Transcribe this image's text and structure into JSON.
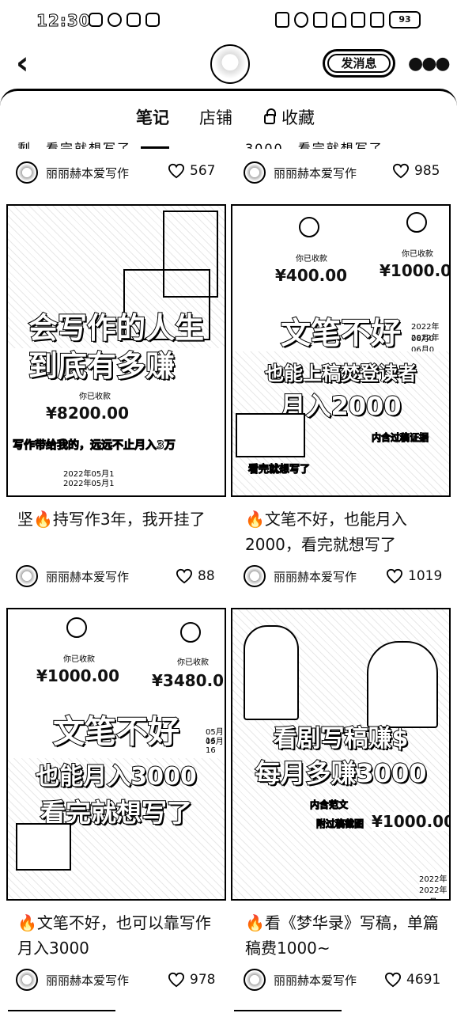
{
  "status_bar": {
    "time": "12:30",
    "battery": "93"
  },
  "header": {
    "back_icon": "chevron-left-icon",
    "message_button": "发消息",
    "more_icon": "more-dots-icon"
  },
  "tabs": [
    {
      "label": "笔记",
      "active": true
    },
    {
      "label": "店铺",
      "active": false
    },
    {
      "label": "收藏",
      "active": false,
      "icon": "lock-icon"
    }
  ],
  "top_partial_row": {
    "left": {
      "partial_text": "剩，看完就想写了",
      "author": "丽丽赫本爱写作",
      "likes": "567"
    },
    "right": {
      "partial_text": "3000，看完就想写了",
      "author": "丽丽赫本爱写作",
      "likes": "985"
    }
  },
  "notes": [
    {
      "cover": {
        "headline_1": "会写作的人生",
        "headline_2": "到底有多赚",
        "amount": "¥8200.00",
        "received": "你已收款",
        "sticker": "写作带给我的，远远不止月入3万",
        "dates": [
          "2022年05月1",
          "2022年05月1"
        ]
      },
      "title": "坚🔥持写作3年，我开挂了",
      "author": "丽丽赫本爱写作",
      "likes": "88"
    },
    {
      "cover": {
        "amount_1": "¥400.00",
        "amount_2": "¥1000.00",
        "received": "你已收款",
        "headline_1": "文笔不好",
        "headline_2": "也能上稿焚登读者",
        "headline_3": "月入2000",
        "sticker_1": "内含过稿证据",
        "sticker_2": "看完就想写了",
        "dates": [
          "2022年06月0",
          "2022年06月0"
        ]
      },
      "title": "🔥文笔不好，也能月入2000，看完就想写了",
      "author": "丽丽赫本爱写作",
      "likes": "1019"
    },
    {
      "cover": {
        "amount_1": "¥1000.00",
        "amount_2": "¥3480.00",
        "received": "你已收款",
        "headline_1": "文笔不好",
        "headline_2": "也能月入3000",
        "headline_3": "看完就想写了",
        "dates": [
          "05月16",
          "05月16"
        ]
      },
      "title": "🔥文笔不好，也可以靠写作月入3000",
      "author": "丽丽赫本爱写作",
      "likes": "978"
    },
    {
      "cover": {
        "headline_1": "看剧写稿赚$",
        "headline_2": "每月多赚3000",
        "sticker_1": "内含范文",
        "sticker_2": "附过稿截图",
        "amount": "¥1000.00",
        "dates": [
          "2022年06月0",
          "2022年06月0"
        ]
      },
      "title": "🔥看《梦华录》写稿，单篇稿费1000~",
      "author": "丽丽赫本爱写作",
      "likes": "4691"
    }
  ]
}
